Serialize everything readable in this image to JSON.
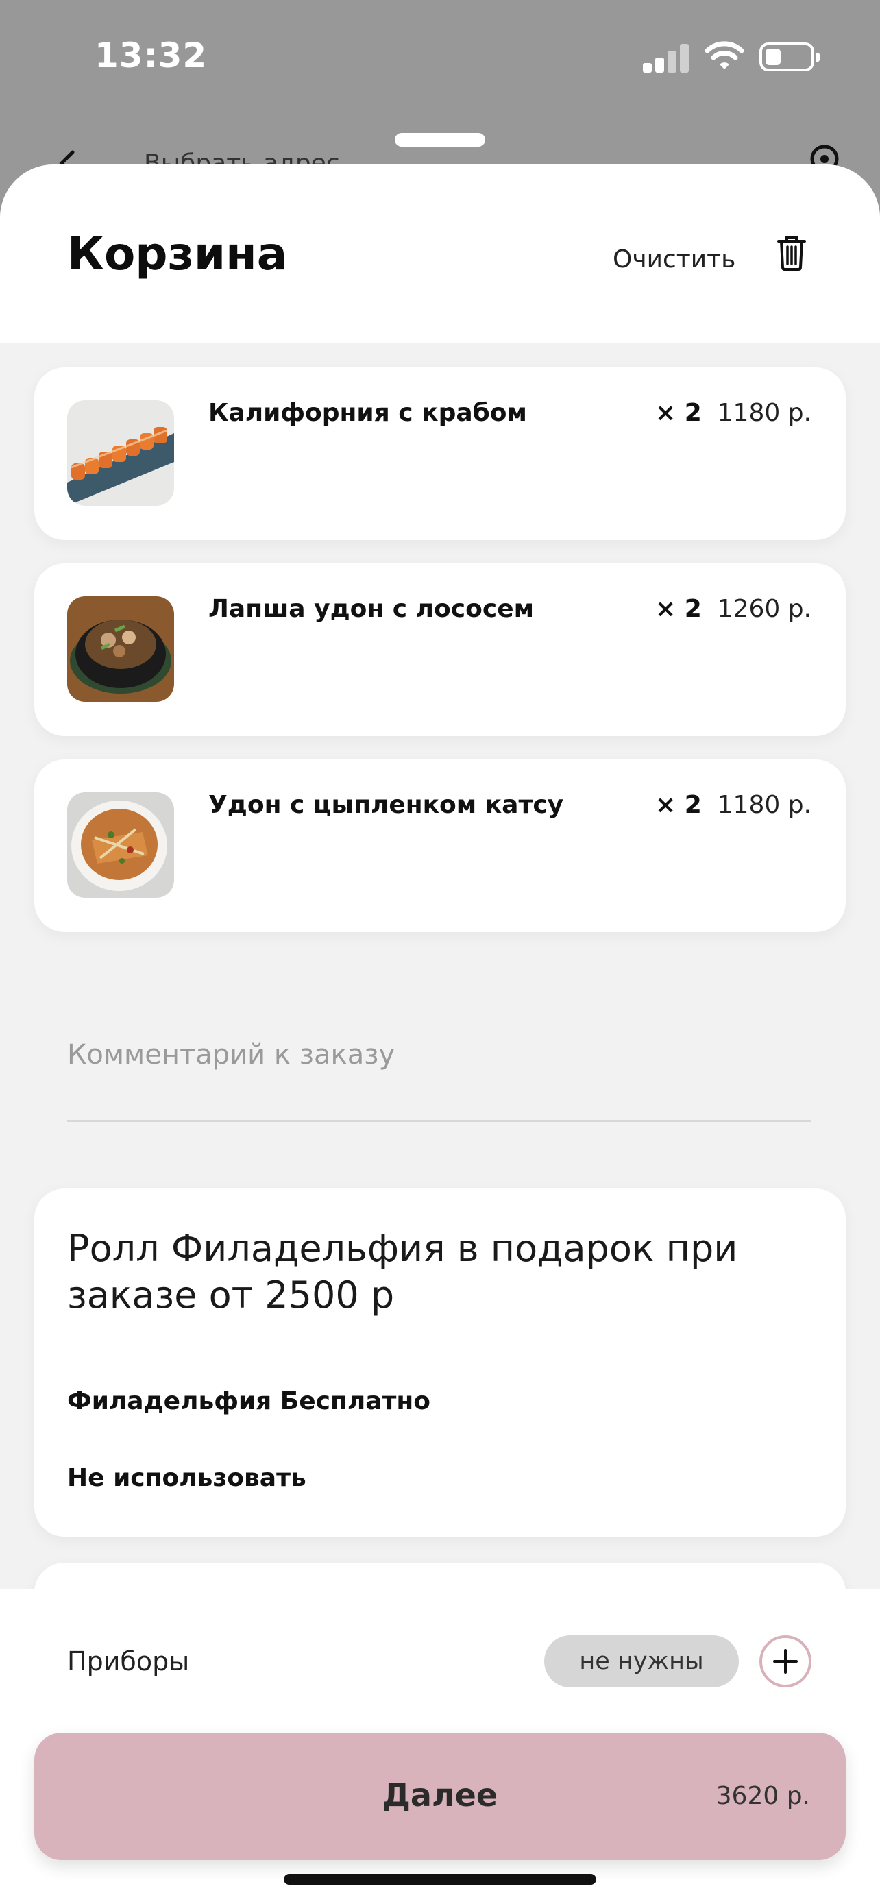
{
  "status_bar": {
    "time": "13:32",
    "icons": [
      "signal-icon",
      "wifi-icon",
      "battery-icon"
    ]
  },
  "background_page": {
    "back_icon": "chevron-left-icon",
    "text": "Выбрать адрес",
    "pin_icon": "location-pin-icon"
  },
  "cart": {
    "title": "Корзина",
    "clear_label": "Очистить",
    "clear_icon": "trash-icon",
    "items": [
      {
        "name": "Калифорния с крабом",
        "qty": "× 2",
        "price": "1180 р."
      },
      {
        "name": "Лапша удон с лососем",
        "qty": "× 2",
        "price": "1260 р."
      },
      {
        "name": "Удон с цыпленком катсу",
        "qty": "× 2",
        "price": "1180 р."
      }
    ],
    "comment_placeholder": "Комментарий к заказу"
  },
  "promo": {
    "title": "Ролл Филадельфия в подарок при заказе от 2500 р",
    "options": [
      "Филадельфия Бесплатно",
      "Не использовать"
    ]
  },
  "utensils": {
    "label": "Приборы",
    "value": "не нужны",
    "add_icon": "plus-icon"
  },
  "footer": {
    "next_label": "Далее",
    "total": "3620 р."
  },
  "colors": {
    "accent": "#d9b3bc",
    "accent_border": "#d9b1bb",
    "sheet_bg": "#f2f2f2",
    "overlay": "#989898"
  }
}
